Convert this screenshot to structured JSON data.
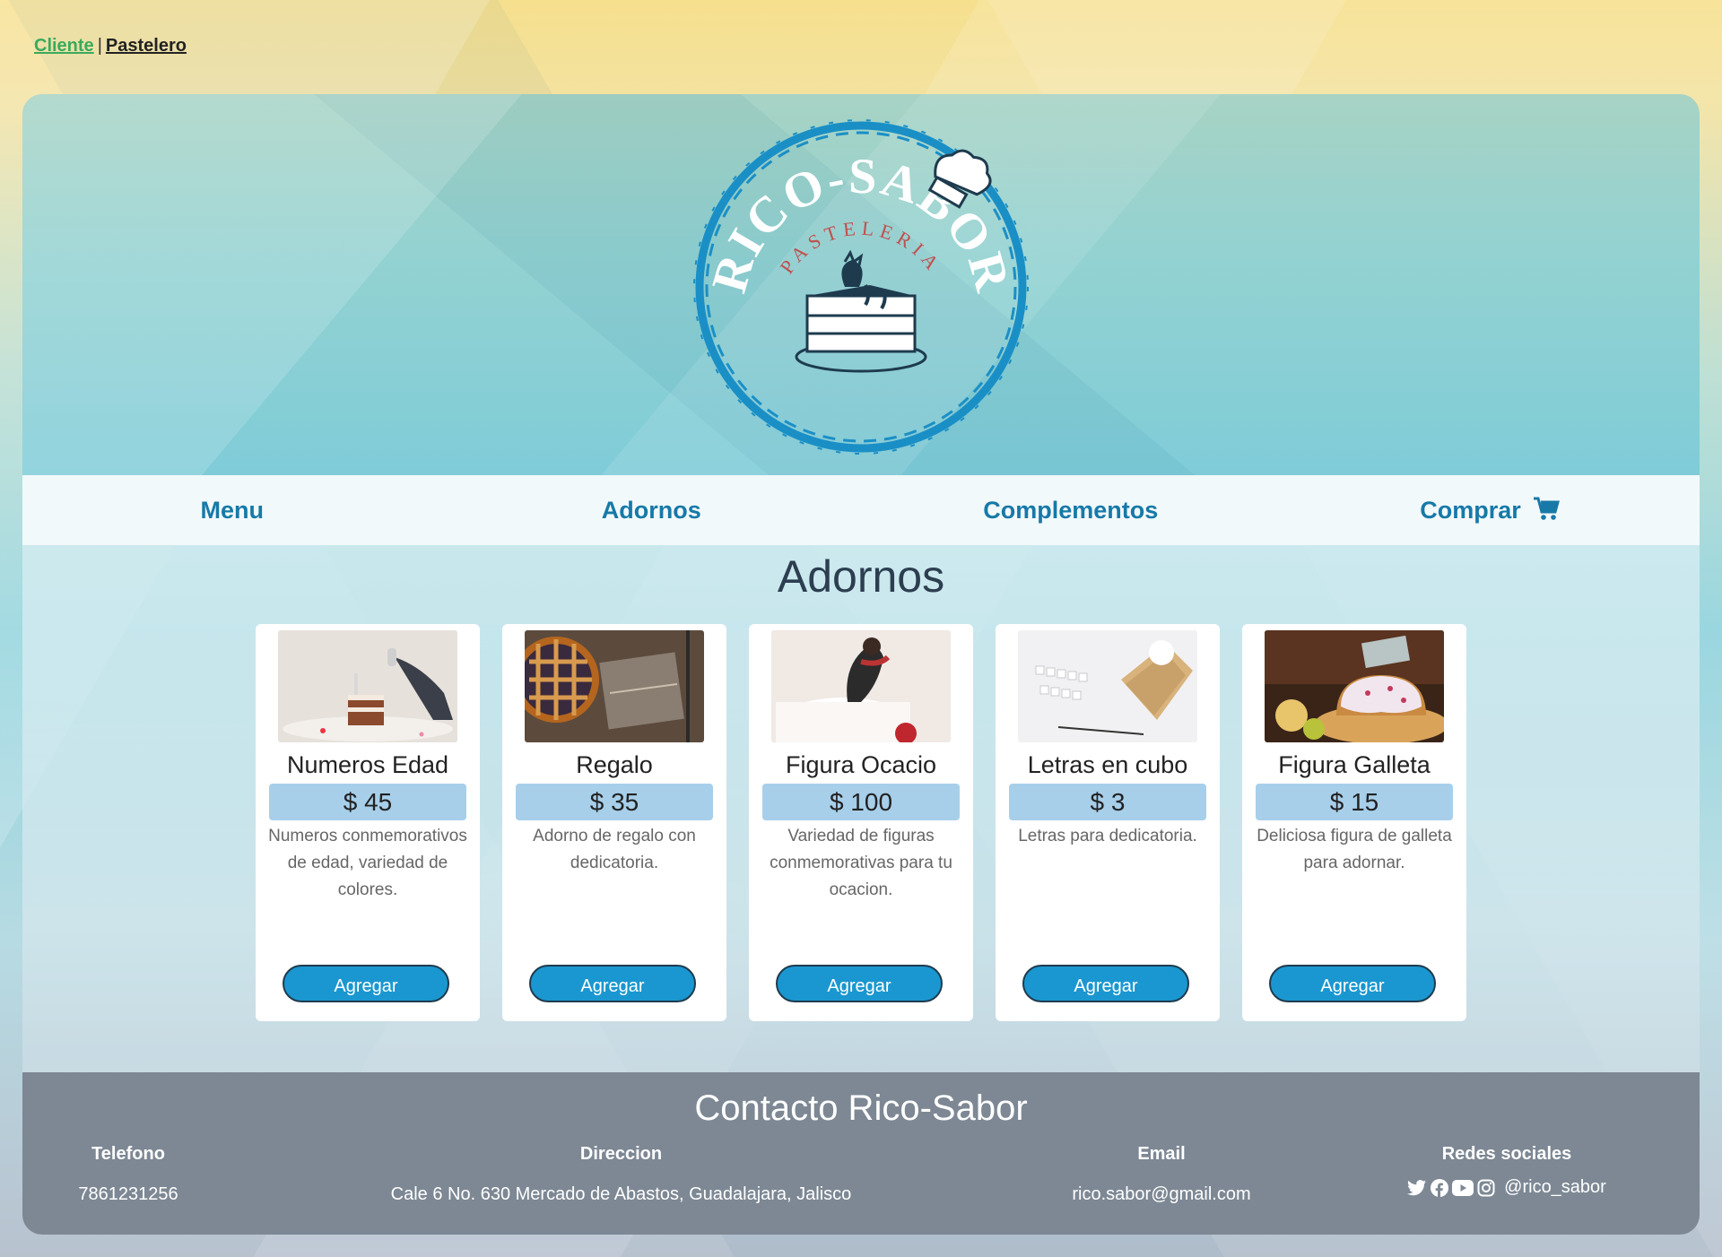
{
  "top_links": {
    "cliente": "Cliente",
    "separator": "|",
    "pastelero": "Pastelero"
  },
  "logo": {
    "brand": "RICO-SABOR",
    "subtitle": "PASTELERIA"
  },
  "nav": {
    "menu": "Menu",
    "adornos": "Adornos",
    "complementos": "Complementos",
    "comprar": "Comprar"
  },
  "section": {
    "title": "Adornos"
  },
  "products": [
    {
      "name": "Numeros Edad",
      "price": "$ 45",
      "description": "Numeros conmemorativos de edad, variedad de colores.",
      "button": "Agregar"
    },
    {
      "name": "Regalo",
      "price": "$ 35",
      "description": "Adorno de regalo con dedicatoria.",
      "button": "Agregar"
    },
    {
      "name": "Figura Ocacio",
      "price": "$ 100",
      "description": "Variedad de figuras conmemorativas para tu ocacion.",
      "button": "Agregar"
    },
    {
      "name": "Letras en cubo",
      "price": "$ 3",
      "description": "Letras para dedicatoria.",
      "button": "Agregar"
    },
    {
      "name": "Figura Galleta",
      "price": "$ 15",
      "description": "Deliciosa figura de galleta para adornar.",
      "button": "Agregar"
    }
  ],
  "footer": {
    "title": "Contacto Rico-Sabor",
    "telefono_label": "Telefono",
    "telefono": "7861231256",
    "direccion_label": "Direccion",
    "direccion": "Cale 6 No. 630 Mercado de Abastos, Guadalajara, Jalisco",
    "email_label": "Email",
    "email": "rico.sabor@gmail.com",
    "redes_label": "Redes sociales",
    "handle": "@rico_sabor"
  },
  "colors": {
    "accent": "#1a97d0",
    "nav_text": "#1779a8",
    "price_bg": "#a7cfea",
    "footer_bg": "#7d8894",
    "cliente_link": "#3aaa5c"
  }
}
